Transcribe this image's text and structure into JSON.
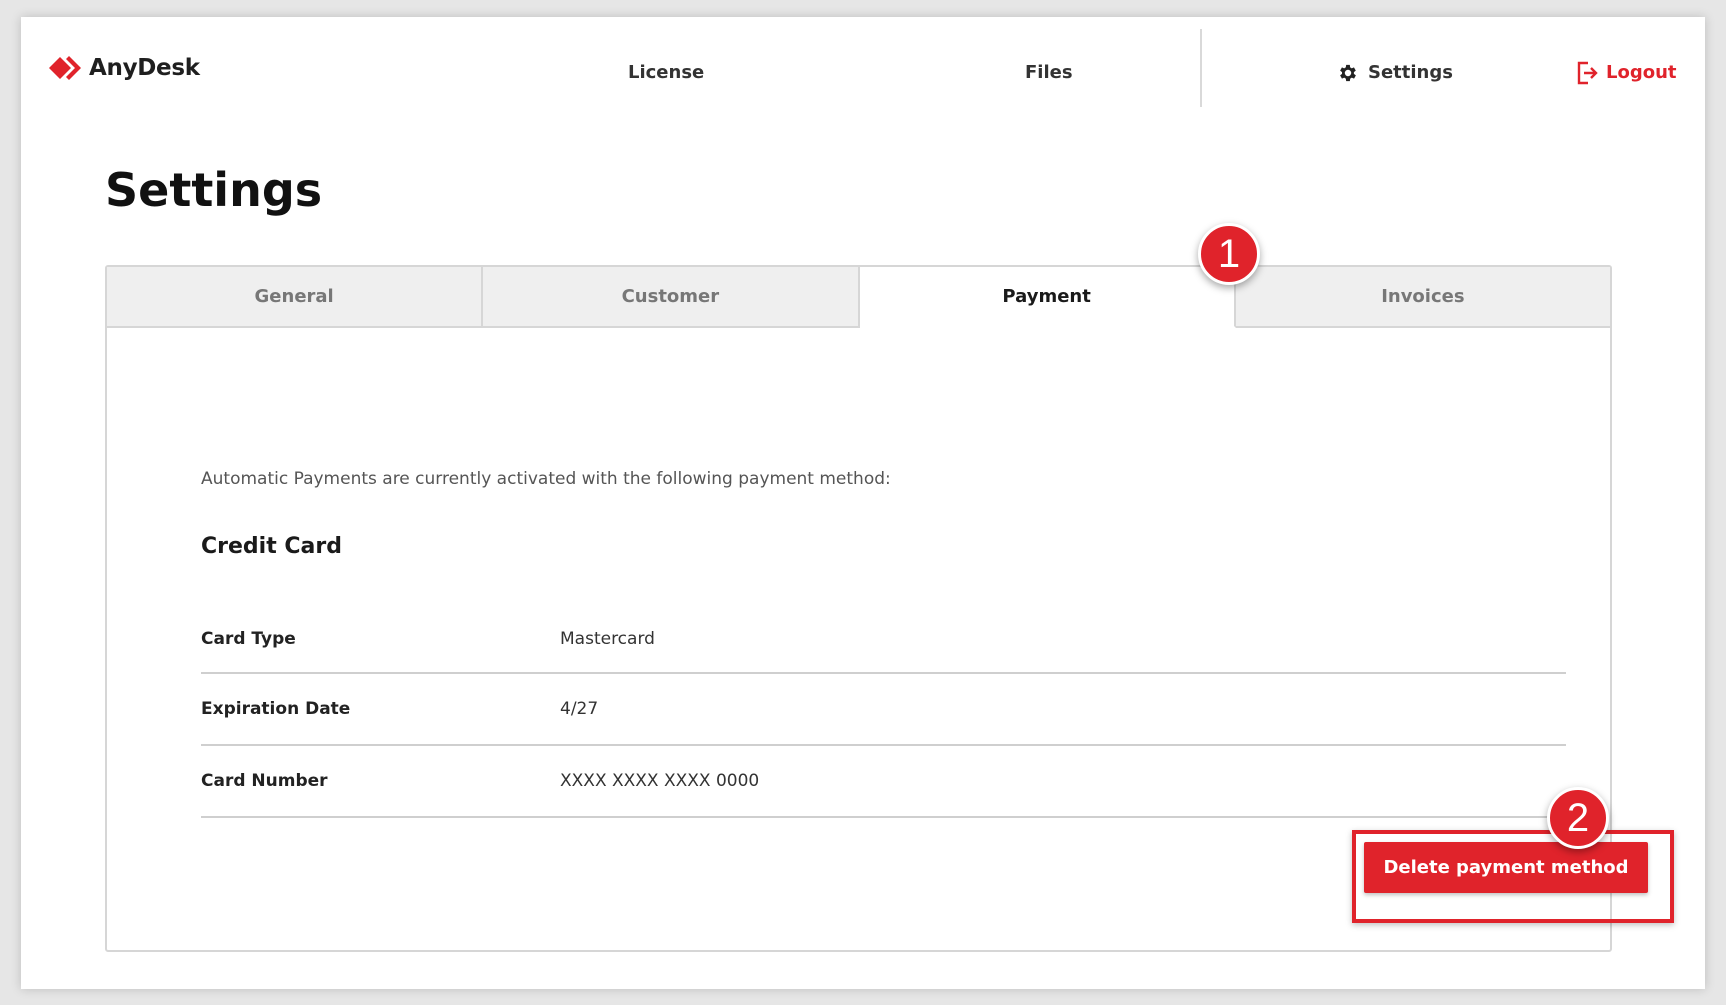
{
  "brand": {
    "name": "AnyDesk",
    "accent": "#e0232b"
  },
  "nav": {
    "license": "License",
    "files": "Files",
    "settings": "Settings",
    "logout": "Logout"
  },
  "page": {
    "title": "Settings"
  },
  "tabs": [
    {
      "label": "General",
      "active": false
    },
    {
      "label": "Customer",
      "active": false
    },
    {
      "label": "Payment",
      "active": true
    },
    {
      "label": "Invoices",
      "active": false
    }
  ],
  "payment": {
    "intro": "Automatic Payments are currently activated with the following payment method:",
    "section_title": "Credit Card",
    "rows": [
      {
        "label": "Card Type",
        "value": "Mastercard"
      },
      {
        "label": "Expiration Date",
        "value": "4/27"
      },
      {
        "label": "Card Number",
        "value": "XXXX XXXX XXXX 0000"
      }
    ],
    "delete_label": "Delete payment method"
  },
  "annotations": {
    "step1": "1",
    "step2": "2"
  }
}
